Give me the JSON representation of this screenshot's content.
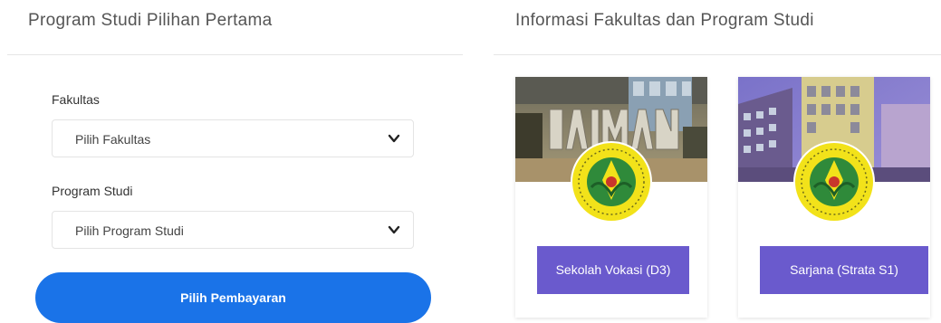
{
  "left": {
    "title": "Program Studi Pilihan Pertama",
    "faculty_label": "Fakultas",
    "faculty_value": "Pilih Fakultas",
    "program_label": "Program Studi",
    "program_value": "Pilih Program Studi",
    "pay_button": "Pilih Pembayaran"
  },
  "right": {
    "title": "Informasi Fakultas dan Program Studi",
    "cards": [
      {
        "button": "Sekolah Vokasi (D3)",
        "photo": "taman-sign-building-photo",
        "logo": "university-emblem"
      },
      {
        "button": "Sarjana (Strata S1)",
        "photo": "campus-building-photo",
        "logo": "university-emblem"
      }
    ]
  },
  "colors": {
    "primary_button": "#1a73e8",
    "card_button": "#6a5acd",
    "emblem": "#f2e21a"
  },
  "icons": {
    "select_chevron": "chevron-down-icon"
  }
}
